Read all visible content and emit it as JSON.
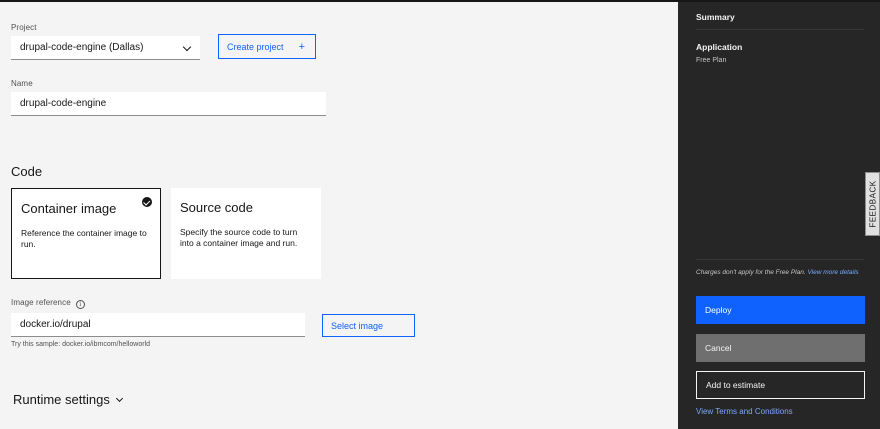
{
  "project": {
    "label": "Project",
    "value": "drupal-code-engine (Dallas)",
    "create_button": "Create project",
    "create_icon": "+"
  },
  "name_field": {
    "label": "Name",
    "value": "drupal-code-engine"
  },
  "code": {
    "title": "Code",
    "tiles": [
      {
        "title": "Container image",
        "description": "Reference the container image to run.",
        "selected": true
      },
      {
        "title": "Source code",
        "description": "Specify the source code to turn into a container image and run.",
        "selected": false
      }
    ]
  },
  "image_reference": {
    "label": "Image reference",
    "info_icon": "i",
    "value": "docker.io/drupal",
    "helper": "Try this sample: docker.io/ibmcom/helloworld",
    "select_button": "Select image"
  },
  "runtime": {
    "title": "Runtime settings"
  },
  "summary": {
    "title": "Summary",
    "application_title": "Application",
    "plan": "Free Plan",
    "charges_text": "Charges don't apply for the Free Plan.",
    "view_more_link": "View more details",
    "deploy_button": "Deploy",
    "cancel_button": "Cancel",
    "estimate_button": "Add to estimate",
    "terms_link": "View Terms and Conditions"
  },
  "feedback": {
    "label": "FEEDBACK"
  },
  "colors": {
    "accent": "#0f62fe",
    "sidebar_bg": "#262626",
    "page_bg": "#f4f4f4"
  }
}
